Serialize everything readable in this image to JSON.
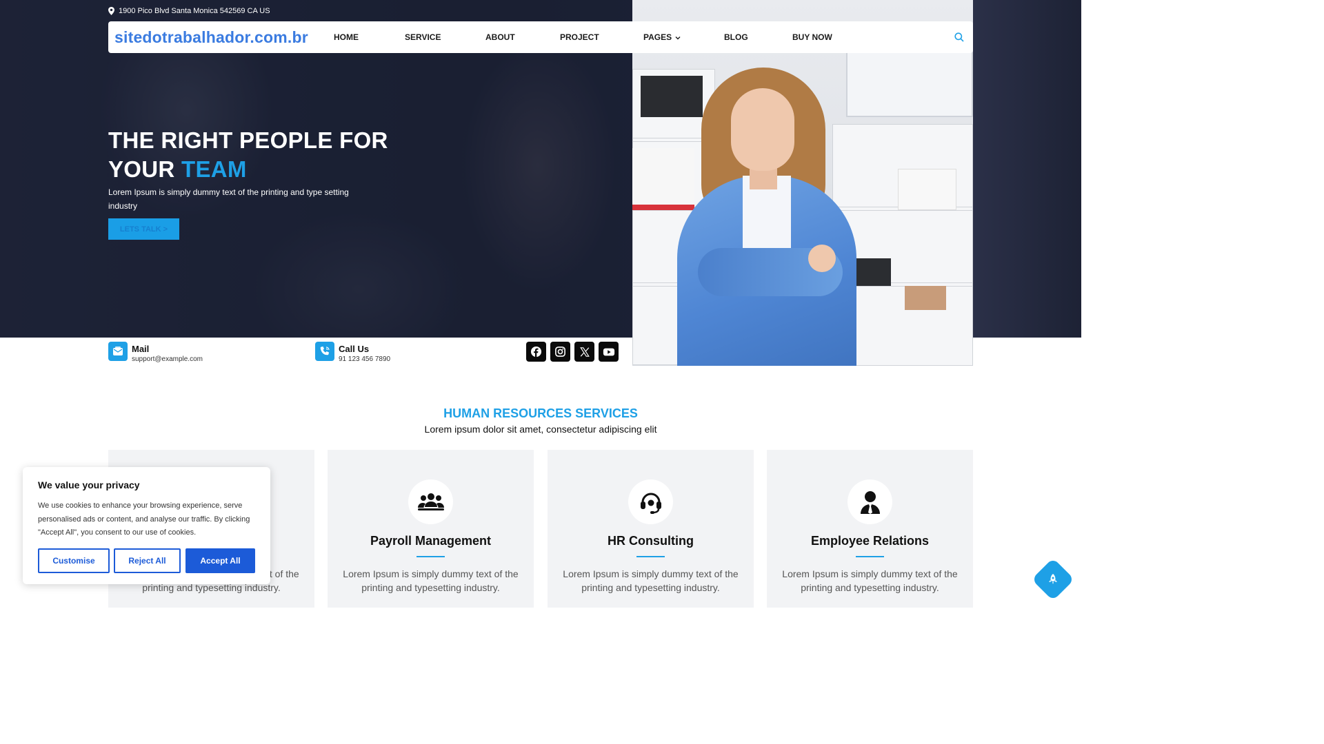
{
  "topbar": {
    "address": "1900 Pico Blvd Santa Monica 542569 CA US"
  },
  "header": {
    "logo": "sitedotrabalhador.com.br",
    "nav": [
      {
        "label": "HOME"
      },
      {
        "label": "SERVICE"
      },
      {
        "label": "ABOUT"
      },
      {
        "label": "PROJECT"
      },
      {
        "label": "PAGES"
      },
      {
        "label": "BLOG"
      },
      {
        "label": "BUY NOW"
      }
    ]
  },
  "hero": {
    "title_line1": "THE RIGHT PEOPLE FOR",
    "title_line2_prefix": "YOUR ",
    "title_accent": "TEAM",
    "subtitle": "Lorem Ipsum is simply dummy text of the printing and type setting industry",
    "cta": "LETS TALK >"
  },
  "contact": {
    "mail_title": "Mail",
    "mail_value": "support@example.com",
    "call_title": "Call Us",
    "call_value": "91 123 456 7890"
  },
  "social": [
    "facebook-icon",
    "instagram-icon",
    "x-icon",
    "youtube-icon"
  ],
  "services": {
    "title": "HUMAN RESOURCES SERVICES",
    "subtitle": "Lorem ipsum dolor sit amet, consectetur adipiscing elit",
    "cards": [
      {
        "title": "",
        "text": "Lorem Ipsum is simply dummy text of the printing and typesetting industry.",
        "icon": "hidden"
      },
      {
        "title": "Payroll Management",
        "text": "Lorem Ipsum is simply dummy text of the printing and typesetting industry.",
        "icon": "users-icon"
      },
      {
        "title": "HR Consulting",
        "text": "Lorem Ipsum is simply dummy text of the printing and typesetting industry.",
        "icon": "headset-icon"
      },
      {
        "title": "Employee Relations",
        "text": "Lorem Ipsum is simply dummy text of the printing and typesetting industry.",
        "icon": "user-tie-icon"
      }
    ]
  },
  "cookie": {
    "title": "We value your privacy",
    "text": "We use cookies to enhance your browsing experience, serve personalised ads or content, and analyse our traffic. By clicking \"Accept All\", you consent to our use of cookies.",
    "customise": "Customise",
    "reject": "Reject All",
    "accept": "Accept All"
  },
  "colors": {
    "accent": "#1ea0e6",
    "logo": "#3a7be0",
    "cookie_button": "#1c5bd8",
    "hero_bg": "#1f2436"
  }
}
